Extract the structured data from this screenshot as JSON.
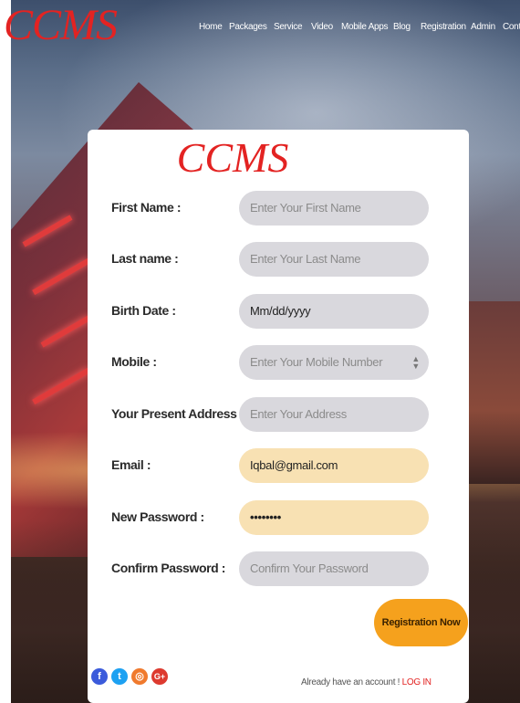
{
  "brand": {
    "logo": "CCMS",
    "accent": "#e32322"
  },
  "nav": {
    "items": [
      "Home",
      "Packages",
      "Service",
      "Video",
      "Mobile Apps",
      "Blog",
      "Registration",
      "Admin",
      "Conta"
    ]
  },
  "form": {
    "title": "CCMS",
    "fields": [
      {
        "label": "First Name :",
        "placeholder": "Enter Your First Name",
        "value": ""
      },
      {
        "label": "Last name :",
        "placeholder": "Enter Your Last Name",
        "value": ""
      },
      {
        "label": "Birth Date :",
        "placeholder": "Mm/dd/yyyy",
        "value": ""
      },
      {
        "label": "Mobile :",
        "placeholder": "Enter Your Mobile Number",
        "value": ""
      },
      {
        "label": "Your Present Address :",
        "placeholder": "Enter Your Address",
        "value": ""
      },
      {
        "label": "Email :",
        "placeholder": "",
        "value": "Iqbal@gmail.com"
      },
      {
        "label": "New Password :",
        "placeholder": "",
        "value": "••••••••"
      },
      {
        "label": "Confirm Password :",
        "placeholder": "Confirm Your Password",
        "value": ""
      }
    ],
    "submit_label": "Registration Now",
    "button_color": "#f5a11d"
  },
  "footer": {
    "already_text": "Already have an account !",
    "login_label": "LOG IN",
    "social": [
      {
        "name": "facebook",
        "glyph": "f",
        "color": "#3b5bdb"
      },
      {
        "name": "twitter",
        "glyph": "t",
        "color": "#1da1f2"
      },
      {
        "name": "instagram",
        "glyph": "◎",
        "color": "#f07a2d"
      },
      {
        "name": "google-plus",
        "glyph": "G+",
        "color": "#dd3a2f"
      }
    ]
  }
}
